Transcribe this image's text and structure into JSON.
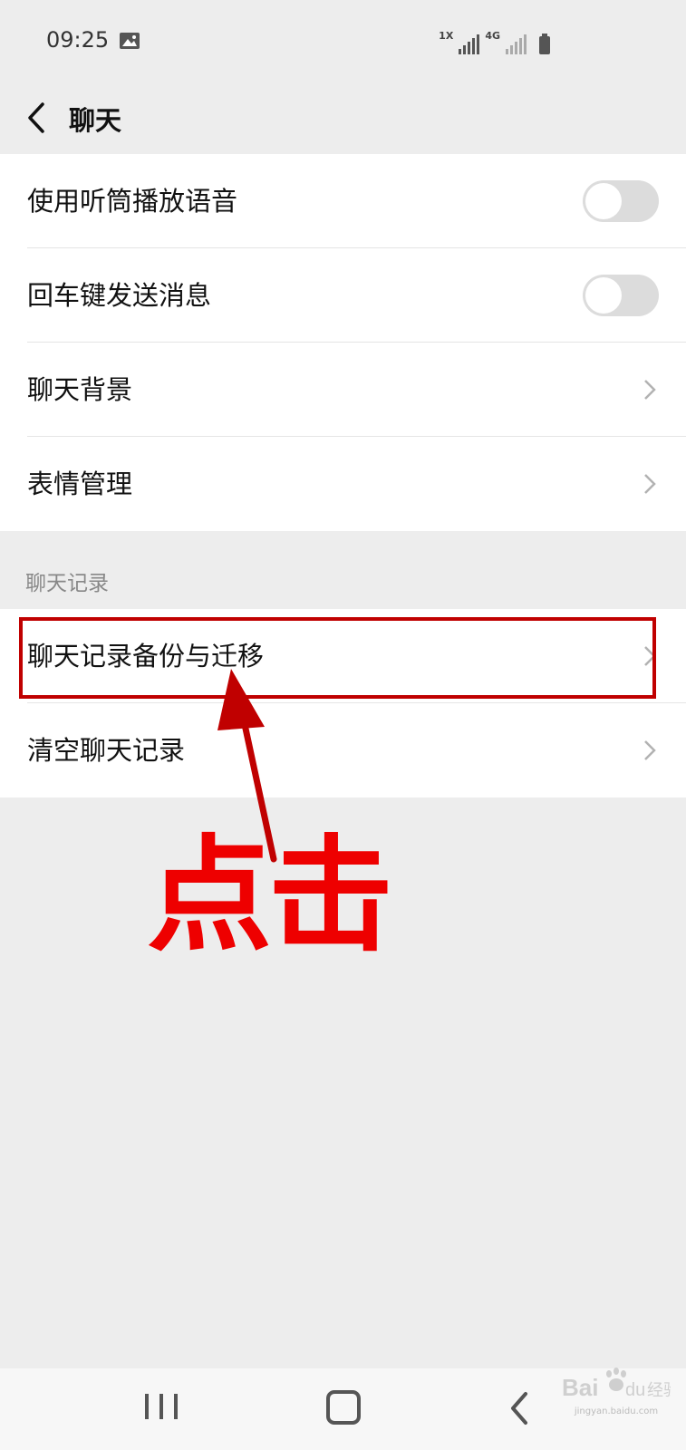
{
  "status_bar": {
    "time": "09:25",
    "sim_tag": "1X",
    "network_tag": "4G",
    "icons": [
      "gallery-icon",
      "signal-icon",
      "signal-icon",
      "battery-icon"
    ]
  },
  "header": {
    "title": "聊天",
    "back_icon": "chevron-left-icon"
  },
  "settings_group": {
    "items": [
      {
        "label": "使用听筒播放语音",
        "control": "toggle",
        "on": false
      },
      {
        "label": "回车键发送消息",
        "control": "toggle",
        "on": false
      },
      {
        "label": "聊天背景",
        "control": "chevron"
      },
      {
        "label": "表情管理",
        "control": "chevron"
      }
    ]
  },
  "chat_history": {
    "header": "聊天记录",
    "items": [
      {
        "label": "聊天记录备份与迁移",
        "control": "chevron"
      },
      {
        "label": "清空聊天记录",
        "control": "chevron"
      }
    ]
  },
  "annotation": {
    "text": "点击",
    "color": "#ee0000",
    "box_color": "#c00000"
  },
  "system_nav": {
    "icons": [
      "recents-icon",
      "home-icon",
      "back-icon"
    ]
  },
  "watermark": {
    "brand": "Bai",
    "brand_suffix": "du",
    "product": "经验",
    "url": "jingyan.baidu.com"
  }
}
